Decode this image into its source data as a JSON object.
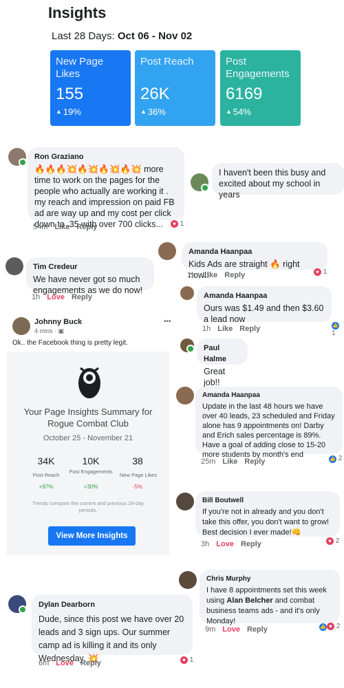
{
  "insights": {
    "title": "Insights",
    "range_prefix": "Last 28 Days:",
    "range_value": "Oct 06 - Nov 02",
    "tiles": [
      {
        "label": "New Page Likes",
        "value": "155",
        "change": "19%"
      },
      {
        "label": "Post Reach",
        "value": "26K",
        "change": "36%"
      },
      {
        "label": "Post Engagements",
        "value": "6169",
        "change": "54%"
      }
    ]
  },
  "comments": {
    "ron": {
      "name": "Ron Graziano",
      "emoji": "🔥🔥🔥💥🔥💥🔥💥🔥💥",
      "text_a": " more time",
      "text_b": "to work on the pages for the people who actually are working it . my reach and impression on paid FB ad are way up and my cost per click down to .35 with over 700 clicks...",
      "time": "54m",
      "like": "Like",
      "reply": "Reply",
      "react_count": "1"
    },
    "school": {
      "text": "I haven't been this busy and excited about my school in years"
    },
    "amanda1": {
      "name": "Amanda Haanpaa",
      "text_a": "Kids Ads are straight ",
      "emoji": "🔥",
      "text_b": " right now!!",
      "time": "1h",
      "like": "Like",
      "reply": "Reply",
      "react_count": "1"
    },
    "tim": {
      "name": "Tim Credeur",
      "text": "We have never got so much engagements as we do now!",
      "time": "1h",
      "love": "Love",
      "reply": "Reply"
    },
    "amanda2": {
      "name": "Amanda Haanpaa",
      "text": "Ours was $1.49 and then $3.60 a lead now",
      "time": "1h",
      "like": "Like",
      "reply": "Reply",
      "react_count": "1"
    },
    "paul": {
      "name": "Paul Halme",
      "text": "Great job!!"
    },
    "amanda3": {
      "name": "Amanda Haanpaa",
      "text": "Update in the last 48 hours we have over 40 leads, 23 scheduled and Friday alone has 9 appointments on! Darby and Erich sales percentage is 89%. Have a goal of adding close to 15-20 more students by month's end",
      "time": "25m",
      "like": "Like",
      "reply": "Reply",
      "react_count": "2"
    },
    "bill": {
      "name": "Bill Boutwell",
      "text": "If you're not in already and you don't take this offer, you don't want to grow!",
      "text2": "Best decision I ever made!",
      "emoji": "👊",
      "time": "3h",
      "love": "Love",
      "reply": "Reply",
      "react_count": "2"
    },
    "chris": {
      "name": "Chris Murphy",
      "text_a": "I have 8 appointments set this week using ",
      "bold": "Alan Belcher",
      "text_b": " and combat business teams ads - and it's only Monday!",
      "time": "9m",
      "love": "Love",
      "reply": "Reply",
      "react_count": "2"
    },
    "dylan": {
      "name": "Dylan Dearborn",
      "text": "Dude, since this post we have over 20 leads and 3 sign ups. Our summer camp ad is killing it and its only Wednesday.",
      "emoji": "💥",
      "time": "6m",
      "love": "Love",
      "reply": "Reply",
      "react_count": "1"
    }
  },
  "post": {
    "name": "Johnny Buck",
    "time": "4 mins · ",
    "menu": "•••",
    "text": "Ok.. the Facebook thing is pretty legit.",
    "summary_title": "Your Page Insights Summary for Rogue Combat Club",
    "summary_dates": "October 25 - November 21",
    "stats": [
      {
        "value": "34K",
        "label": "Post Reach",
        "pct": "+97%"
      },
      {
        "value": "10K",
        "label": "Post Engagements",
        "pct": "+30%"
      },
      {
        "value": "38",
        "label": "New Page Likes",
        "pct": "-5%"
      }
    ],
    "trend_note": "Trends compare the current and previous 28-day periods.",
    "button": "View More Insights"
  },
  "colors": {
    "blue": "#1877f2",
    "light_blue": "#31a3f0",
    "teal": "#2bb3a0",
    "love": "#e4405f",
    "positive": "#31a24c",
    "negative": "#e4405f"
  }
}
